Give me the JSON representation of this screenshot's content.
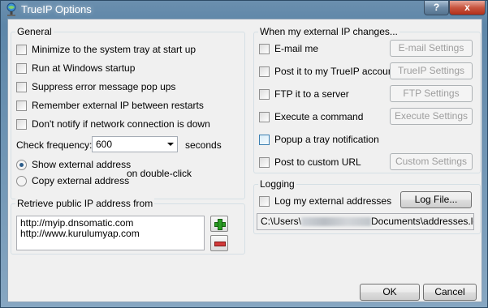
{
  "window": {
    "title": "TrueIP Options",
    "help_label": "?",
    "close_label": "x"
  },
  "general": {
    "title": "General",
    "options": [
      {
        "label": "Minimize to the system tray at start up",
        "checked": false
      },
      {
        "label": "Run at Windows startup",
        "checked": false
      },
      {
        "label": "Suppress error message pop ups",
        "checked": false
      },
      {
        "label": "Remember external IP between restarts",
        "checked": false
      },
      {
        "label": "Don't notify if network connection is down",
        "checked": false
      }
    ],
    "check_frequency_label": "Check frequency:",
    "check_frequency_value": "600",
    "check_frequency_unit": "seconds",
    "radio_options": [
      {
        "label": "Show external address",
        "checked": true
      },
      {
        "label": "Copy external address",
        "checked": false
      }
    ],
    "radio_suffix": "on double-click"
  },
  "retrieve": {
    "title": "Retrieve public IP address from",
    "urls": [
      "http://myip.dnsomatic.com",
      "http://www.kurulumyap.com"
    ]
  },
  "ip_changes": {
    "title": "When my external IP changes...",
    "actions": [
      {
        "label": "E-mail me",
        "button": "E-mail Settings"
      },
      {
        "label": "Post it to my TrueIP account",
        "button": "TrueIP Settings"
      },
      {
        "label": "FTP it to a server",
        "button": "FTP Settings"
      },
      {
        "label": "Execute a command",
        "button": "Execute Settings"
      },
      {
        "label": "Popup a tray notification",
        "button": ""
      },
      {
        "label": "Post to custom URL",
        "button": "Custom Settings"
      }
    ]
  },
  "logging": {
    "title": "Logging",
    "log_label": "Log my external addresses",
    "log_file_button": "Log File...",
    "path_prefix": "C:\\Users\\",
    "path_suffix": "Documents\\addresses.log"
  },
  "footer": {
    "ok_label": "OK",
    "cancel_label": "Cancel"
  },
  "colors": {
    "title_bar": "#5d86a8",
    "dialog_bg": "#f0f0f0",
    "add_icon": "#2a9c24",
    "remove_icon": "#d23a3a"
  }
}
